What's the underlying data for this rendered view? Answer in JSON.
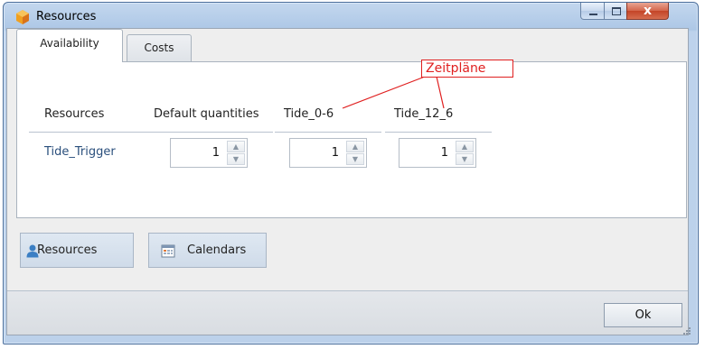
{
  "window": {
    "title": "Resources",
    "controls": {
      "minimize": "",
      "maximize": "",
      "close": "x"
    }
  },
  "tabs": [
    {
      "label": "Availability",
      "active": true
    },
    {
      "label": "Costs",
      "active": false
    }
  ],
  "annotation": {
    "label": "Zeitpläne",
    "color": "#e02020"
  },
  "grid": {
    "headers": [
      "Resources",
      "Default quantities",
      "Tide_0-6",
      "Tide_12_6"
    ],
    "rows": [
      {
        "name": "Tide_Trigger",
        "default_quantity": "1",
        "tide_0_6": "1",
        "tide_12_6": "1"
      }
    ]
  },
  "toolbar": {
    "resources_label": "Resources",
    "resources_icon": "user-icon",
    "calendars_label": "Calendars",
    "calendars_icon": "calendar-icon"
  },
  "footer": {
    "ok_label": "Ok"
  },
  "colors": {
    "accent": "#2a4f7c",
    "annotation": "#e02020",
    "app_icon": "#f0a020"
  }
}
